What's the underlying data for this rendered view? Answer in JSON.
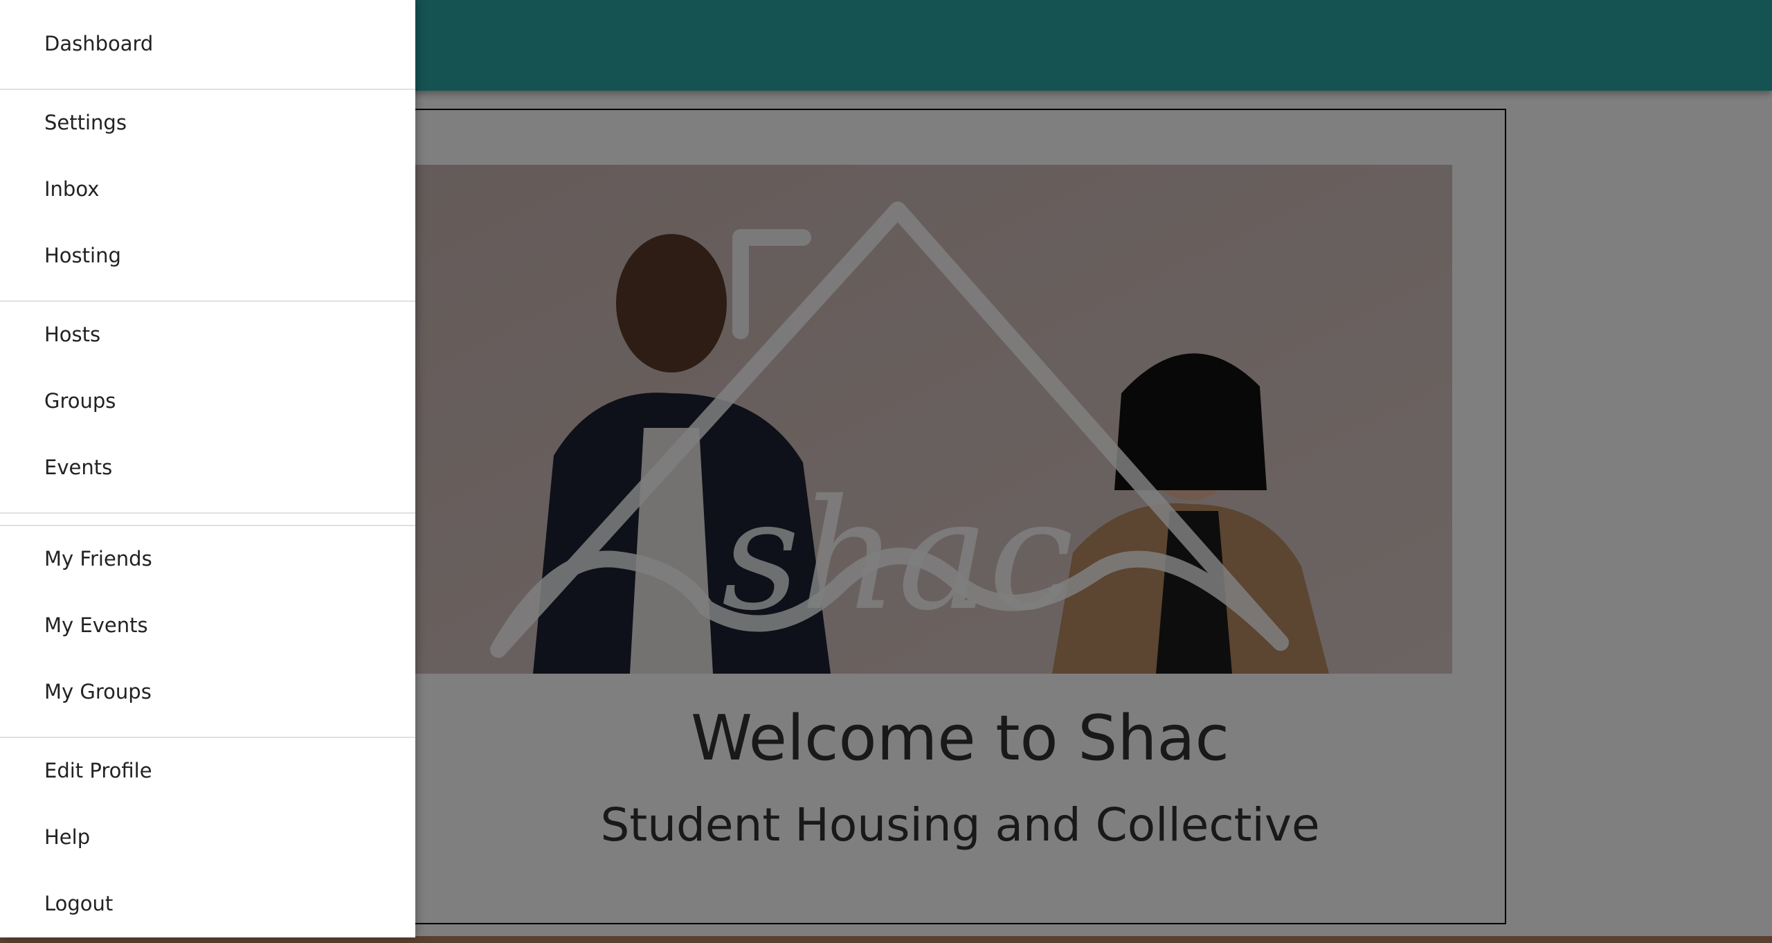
{
  "drawer": {
    "items": [
      {
        "label": "Dashboard"
      },
      {
        "label": "Settings"
      },
      {
        "label": "Inbox"
      },
      {
        "label": "Hosting"
      },
      {
        "label": "Hosts"
      },
      {
        "label": "Groups"
      },
      {
        "label": "Events"
      },
      {
        "label": "My Friends"
      },
      {
        "label": "My Events"
      },
      {
        "label": "My Groups"
      },
      {
        "label": "Edit Profile"
      },
      {
        "label": "Help"
      },
      {
        "label": "Logout"
      }
    ]
  },
  "hero": {
    "logo_text": "shac"
  },
  "welcome": {
    "title": "Welcome to Shac",
    "subtitle": "Student Housing and Collective"
  },
  "colors": {
    "app_bar": "#2aa6a6",
    "scrim": "rgba(0,0,0,0.5)",
    "drawer_bg": "#ffffff"
  }
}
